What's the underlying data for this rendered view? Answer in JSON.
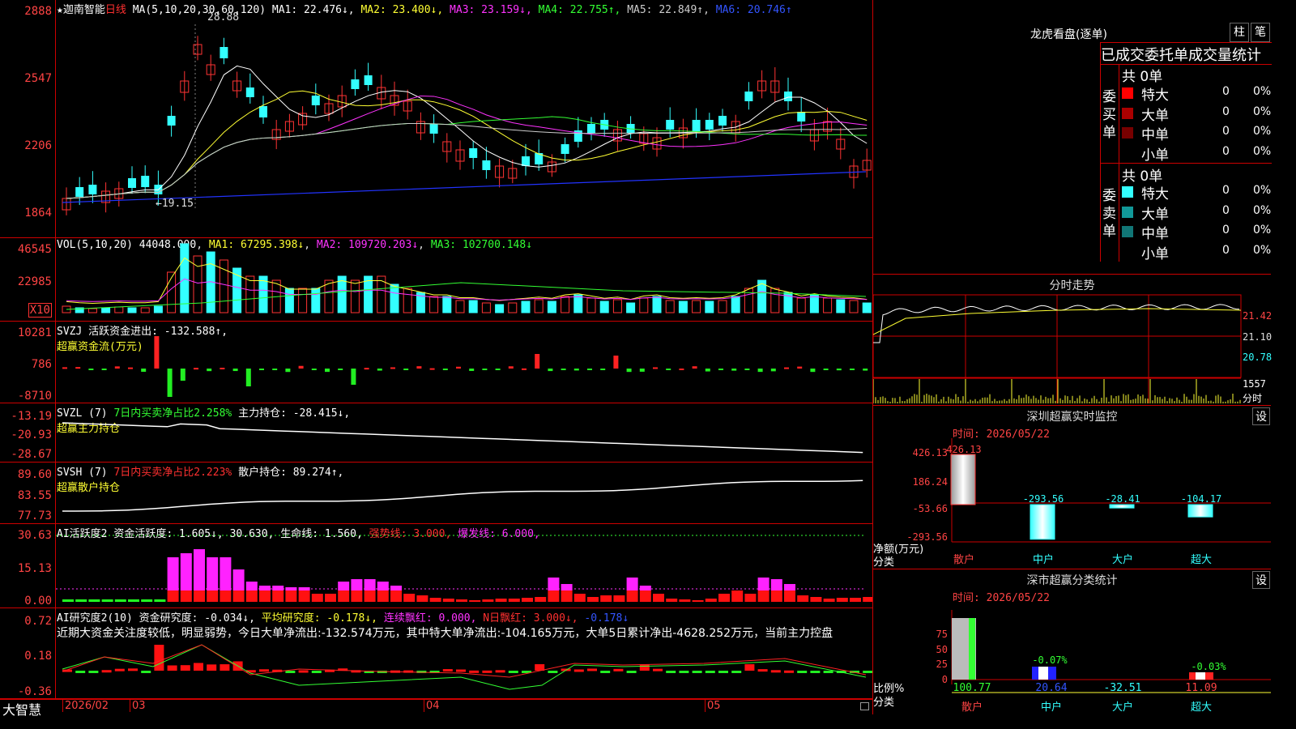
{
  "kline": {
    "star": "★",
    "name": "迦南智能",
    "period": "日线",
    "ma_title": "MA(5,10,20,30,60,120)",
    "ma": [
      {
        "label": "MA1:",
        "value": "22.476",
        "arrow": "↓",
        "color": "#ffffff"
      },
      {
        "label": "MA2:",
        "value": "23.400",
        "arrow": "↓",
        "color": "#ffff33"
      },
      {
        "label": "MA3:",
        "value": "23.159",
        "arrow": "↓",
        "color": "#ff33ff"
      },
      {
        "label": "MA4:",
        "value": "22.755",
        "arrow": "↑",
        "color": "#33ff33"
      },
      {
        "label": "MA5:",
        "value": "22.849",
        "arrow": "↑",
        "color": "#cccccc"
      },
      {
        "label": "MA6:",
        "value": "20.746",
        "arrow": "↑",
        "color": "#3355ff"
      }
    ],
    "axis": [
      "2888",
      "2547",
      "2206",
      "1864"
    ],
    "high_mark": "28.88",
    "low_mark": "←19.15"
  },
  "vol": {
    "title": "VOL(5,10,20)",
    "v": "44048.000",
    "ma1": "MA1: 67295.398↓",
    "ma2": "MA2: 109720.203↓",
    "ma3": "MA3: 102700.148↓",
    "axis": [
      "46545",
      "22985"
    ],
    "unit": "X10"
  },
  "svzj": {
    "title": "SVZJ",
    "l1": "活跃资金进出: -132.588↑,",
    "l2": "超赢资金流(万元)",
    "axis": [
      "10281",
      "786",
      "-8710"
    ]
  },
  "svzl": {
    "title": "SVZL (7)",
    "l1a": "7日内买卖净占比2.258%",
    "l1b": "主力持仓: -28.415↓,",
    "l2": "超赢主力持仓",
    "axis": [
      "-13.19",
      "-20.93",
      "-28.67"
    ]
  },
  "svsh": {
    "title": "SVSH (7)",
    "l1a": "7日内买卖净占比2.223%",
    "l1b": "散户持仓: 89.274↑,",
    "l2": "超赢散户持仓",
    "axis": [
      "89.60",
      "83.55",
      "77.73"
    ]
  },
  "ai2": {
    "title": "AI活跃度2",
    "a": "资金活跃度: 1.605↓,",
    "b": "30.630,",
    "c": "生命线: 1.560,",
    "d": "强势线: 3.000,",
    "e": "爆发线: 6.000,",
    "axis": [
      "30.63",
      "15.13",
      "0.00"
    ]
  },
  "air": {
    "title": "AI研究度2(10)",
    "a": "资金研究度: -0.034↓,",
    "b": "平均研究度: -0.178↓,",
    "c": "连续飘红: 0.000,",
    "d": "N日飘红: 3.000↓,",
    "e": "-0.178↓",
    "text": "近期大资金关注度较低，明显弱势，今日大单净流出:-132.574万元，其中特大单净流出:-104.165万元，大单5日累计净出-4628.252万元，当前主力控盘",
    "axis": [
      "0.72",
      "0.18",
      "-0.36"
    ]
  },
  "bottom": {
    "brand": "大智慧",
    "dates": [
      "2026/02",
      "03",
      "04",
      "05"
    ]
  },
  "lhb": {
    "title": "龙虎看盘(逐单)",
    "btn1": "柱",
    "btn2": "笔",
    "header": "已成交委托单成交量统计",
    "buy": {
      "side": "委买单",
      "total": "共 0单",
      "rows": [
        {
          "label": "特大",
          "v": "0",
          "p": "0%",
          "color": "#ff0000"
        },
        {
          "label": "大单",
          "v": "0",
          "p": "0%",
          "color": "#aa0000"
        },
        {
          "label": "中单",
          "v": "0",
          "p": "0%",
          "color": "#770000"
        },
        {
          "label": "小单",
          "v": "0",
          "p": "0%",
          "color": "#000000"
        }
      ]
    },
    "sell": {
      "side": "委卖单",
      "total": "共 0单",
      "rows": [
        {
          "label": "特大",
          "v": "0",
          "p": "0%",
          "color": "#33ffff"
        },
        {
          "label": "大单",
          "v": "0",
          "p": "0%",
          "color": "#119999"
        },
        {
          "label": "中单",
          "v": "0",
          "p": "0%",
          "color": "#117777"
        },
        {
          "label": "小单",
          "v": "0",
          "p": "0%",
          "color": "#000000"
        }
      ]
    }
  },
  "fenshi": {
    "title": "分时走势",
    "axis": [
      "21.42",
      "21.10",
      "20.78",
      "1557",
      "分时"
    ]
  },
  "sz_rt": {
    "title": "深圳超赢实时监控",
    "btn": "设",
    "time": "时间: 2026/05/22",
    "axis": [
      "426.13",
      "186.24",
      "-53.66",
      "-293.56"
    ],
    "ylab": "净额(万元)",
    "xlab": "分类",
    "cats": [
      "散户",
      "中户",
      "大户",
      "超大"
    ],
    "vals": [
      "426.13",
      "-293.56",
      "-28.41",
      "-104.17"
    ]
  },
  "sz_cls": {
    "title": "深市超赢分类统计",
    "btn": "设",
    "time": "时间: 2026/05/22",
    "axis": [
      "75",
      "50",
      "25",
      "0"
    ],
    "ylab": "比例%",
    "xlab": "分类",
    "cats": [
      "散户",
      "中户",
      "大户",
      "超大"
    ],
    "vals": [
      "100.77",
      "20.64",
      "-32.51",
      "11.09"
    ],
    "notes": [
      "-0.07%",
      "-0.03%"
    ]
  }
}
